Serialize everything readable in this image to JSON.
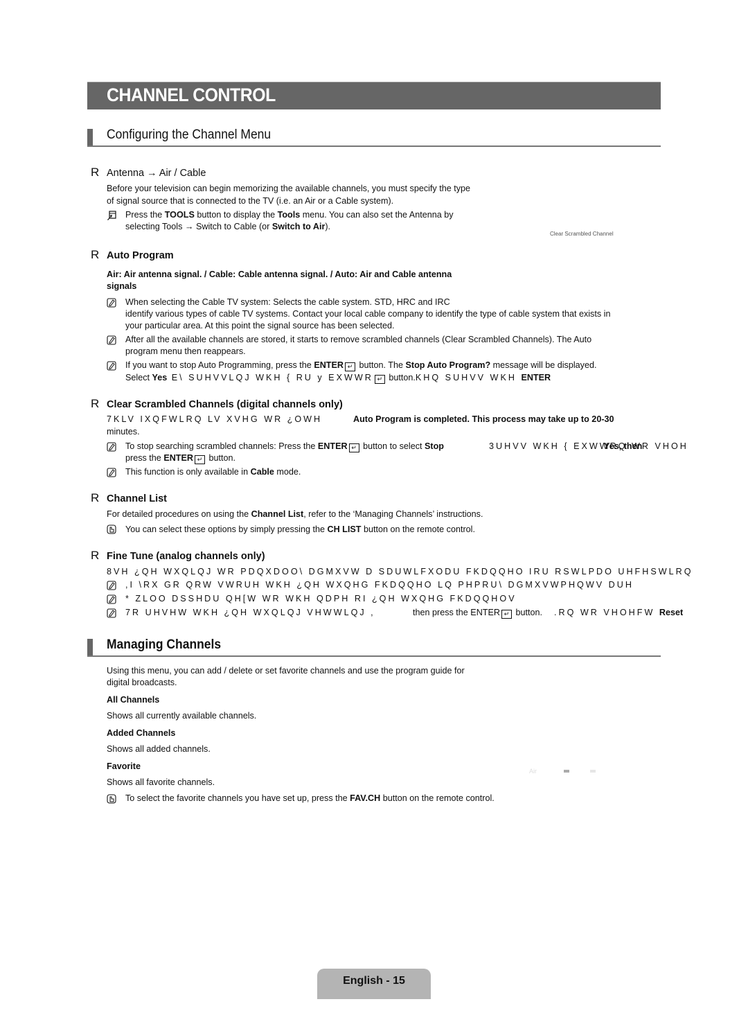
{
  "page": {
    "title": "CHANNEL CONTROL",
    "footer": "English - 15"
  },
  "sections": {
    "configuring": {
      "heading": "Configuring the Channel Menu",
      "antenna": {
        "bullet": "R",
        "label": "Antenna → Air / Cable",
        "desc_line1": "Before your television can begin memorizing the available channels, you must specify the type",
        "desc_line2": "of signal source that is connected to the TV (i.e. an Air or a Cable system).",
        "tools_note": {
          "icon": "tools-icon",
          "line1_a": "Press the ",
          "line1_b": "TOOLS",
          "line1_c": " button to display the ",
          "line1_d": "Tools",
          "line1_e": " menu. You can also set the Antenna by",
          "line2_a": "selecting Tools → Switch to Cable    (or ",
          "line2_b": "Switch to Air",
          "line2_c": ")."
        },
        "side_label": "Clear Scrambled Channel"
      },
      "auto_program": {
        "bullet": "R",
        "label": "Auto Program",
        "bold_line1": "Air: Air antenna signal. / Cable: Cable antenna signal. / Auto: Air and Cable antenna",
        "bold_line2": "signals",
        "notes": [
          {
            "icon": "note-icon",
            "line1": "When selecting the Cable TV system: Selects the cable system. STD, HRC and IRC",
            "line2": "identify various types of cable TV systems. Contact your local cable company to identify the type of cable system that exists in",
            "line3": "your particular area. At this point the signal source has been selected."
          },
          {
            "icon": "note-icon",
            "line1": "After all the available channels are stored, it starts to remove scrambled channels (Clear Scrambled Channels). The Auto",
            "line2": "program menu then reappears."
          },
          {
            "icon": "note-icon",
            "line1_a": "If you want to stop Auto Programming, press the ",
            "line1_b": "ENTER",
            "line1_c": " button. The ",
            "line1_d": "Stop Auto Program?",
            "line1_e": " message will be displayed.",
            "line2_a": "Select ",
            "line2_b": "Yes",
            "line2_c": " E\\ SUHVVLQJ WKH { RU y EXWWR",
            "line2_d": " button.",
            "line2_e": "KHQ SUHVV WKH ",
            "line2_f": "ENTER"
          }
        ]
      },
      "clear_scrambled": {
        "bullet": "R",
        "label": "Clear Scrambled Channels (digital channels only)",
        "desc_garbled": "7KLV IXQFWLRQ LV XVHG WR ¿OWH",
        "desc_overlay": "Auto Program is completed. This process may take up to 20-30",
        "desc_line2": "minutes.",
        "notes": [
          {
            "icon": "note-icon",
            "line1_a": "To stop searching scrambled channels: Press the ",
            "line1_b": "ENTER",
            "line1_c": " button to select ",
            "line1_d": "Stop",
            "line1_garbled": "3UHVV WKH { EXWWRQ WR VHOH",
            "line1_overlay": "Yes, then",
            "line2_a": "press the ",
            "line2_b": "ENTER",
            "line2_c": " button."
          },
          {
            "icon": "note-icon",
            "line1_a": "This function is only available in ",
            "line1_b": "Cable",
            "line1_c": " mode."
          }
        ]
      },
      "channel_list": {
        "bullet": "R",
        "label": "Channel List",
        "desc_a": "For detailed procedures on using the ",
        "desc_b": "Channel List",
        "desc_c": ", refer to the ‘Managing Channels’ instructions.",
        "note": {
          "icon": "remote-icon",
          "text_a": "You can select these options by simply pressing the ",
          "text_b": "CH LIST",
          "text_c": " button on the remote control."
        }
      },
      "fine_tune": {
        "bullet": "R",
        "label": "Fine Tune (analog channels only)",
        "desc_garbled": "8VH ¿QH WXQLQJ WR PDQXDOO\\ DGMXVW D SDUWLFXODU FKDQQHO IRU RSWLPDO UHFHSWLRQ",
        "notes": [
          {
            "icon": "note-icon",
            "garbled": ",I \\RX GR QRW VWRUH WKH ¿QH WXQHG FKDQQHO LQ PHPRU\\  DGMXVWPHQWV DUH"
          },
          {
            "icon": "note-icon",
            "garbled": "* ZLOO DSSHDU QH[W WR WKH QDPH RI ¿QH WXQHG FKDQQHOV"
          },
          {
            "icon": "note-icon",
            "garbled_a": "7R UHVHW WKH ¿QH WXQLQJ VHWWLQJ ,",
            "overlay": "then press the ENTER",
            "overlay_b": " button.",
            "garbled_b": ".RQ WR VHOHFW ",
            "bold_end": "Reset"
          }
        ]
      }
    },
    "managing": {
      "heading": "Managing Channels",
      "intro_line1": "Using this menu, you can add / delete or set favorite channels and use the program guide for",
      "intro_line2": "digital broadcasts.",
      "items": [
        {
          "title": "All Channels",
          "desc": "Shows all currently available channels."
        },
        {
          "title": "Added Channels",
          "desc": "Shows all added channels."
        },
        {
          "title": "Favorite",
          "desc": "Shows all favorite channels."
        }
      ],
      "side_label": "Air",
      "note": {
        "icon": "remote-icon",
        "text_a": "To select the favorite channels you have set up, press the ",
        "text_b": "FAV.CH",
        "text_c": " button on the remote control."
      }
    }
  }
}
